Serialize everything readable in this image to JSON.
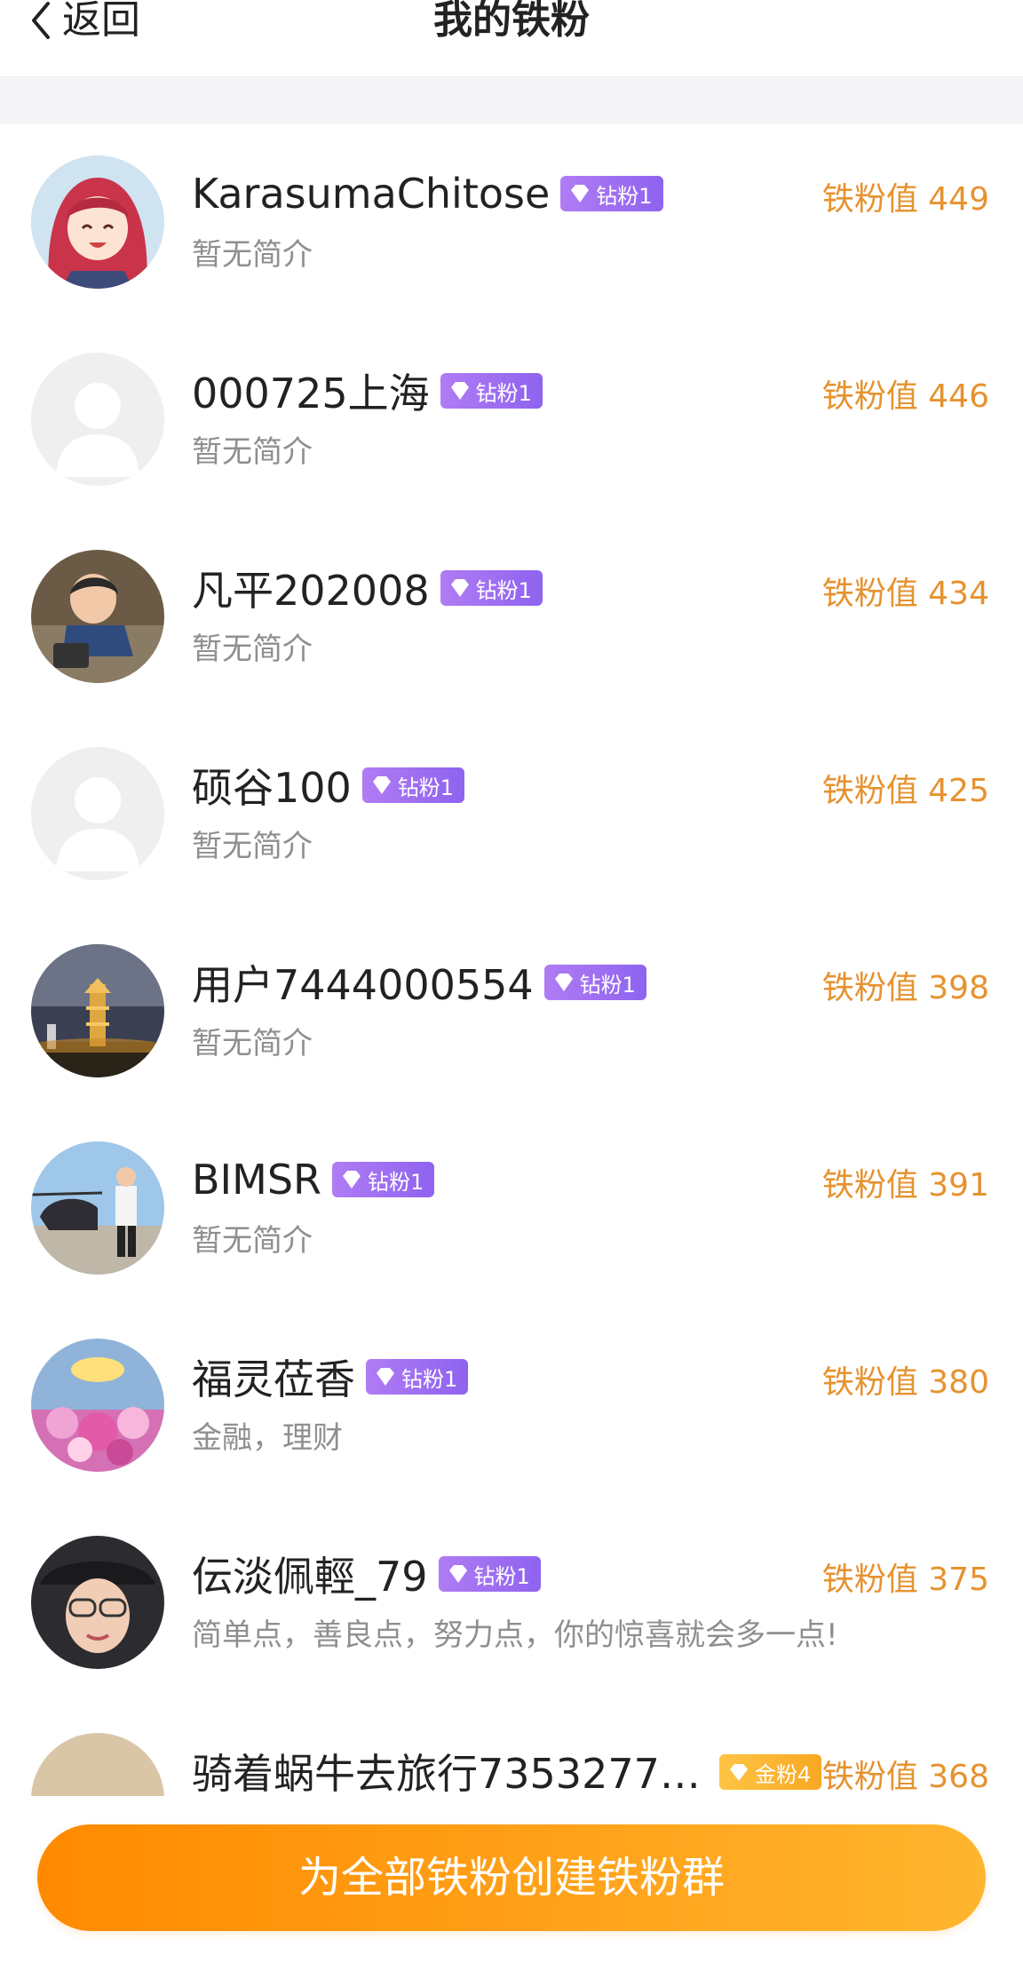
{
  "header": {
    "back_label": "返回",
    "title": "我的铁粉"
  },
  "fans": [
    {
      "name": "KarasumaChitose",
      "badge": "钻粉1",
      "badge_type": "diamond",
      "bio": "暂无简介",
      "score": "铁粉值 449",
      "avatar": "anime-girl"
    },
    {
      "name": "000725上海",
      "badge": "钻粉1",
      "badge_type": "diamond",
      "bio": "暂无简介",
      "score": "铁粉值 446",
      "avatar": "default"
    },
    {
      "name": "凡平202008",
      "badge": "钻粉1",
      "badge_type": "diamond",
      "bio": "暂无简介",
      "score": "铁粉值 434",
      "avatar": "child-photo"
    },
    {
      "name": "硕谷100",
      "badge": "钻粉1",
      "badge_type": "diamond",
      "bio": "暂无简介",
      "score": "铁粉值 425",
      "avatar": "default"
    },
    {
      "name": "用户7444000554",
      "badge": "钻粉1",
      "badge_type": "diamond",
      "bio": "暂无简介",
      "score": "铁粉值 398",
      "avatar": "pagoda-night"
    },
    {
      "name": "BIMSR",
      "badge": "钻粉1",
      "badge_type": "diamond",
      "bio": "暂无简介",
      "score": "铁粉值 391",
      "avatar": "helicopter-photo"
    },
    {
      "name": "福灵莅香",
      "badge": "钻粉1",
      "badge_type": "diamond",
      "bio": "金融，理财",
      "score": "铁粉值 380",
      "avatar": "flowers"
    },
    {
      "name": "伝淡佩輕_79",
      "badge": "钻粉1",
      "badge_type": "diamond",
      "bio": "简单点，善良点，努力点，你的惊喜就会多一点!",
      "score": "铁粉值 375",
      "avatar": "woman-hat"
    },
    {
      "name": "骑着蜗牛去旅行7353277…",
      "badge": "金粉4",
      "badge_type": "gold",
      "bio": "",
      "score": "铁粉值 368",
      "avatar": "partial"
    }
  ],
  "cta": {
    "label": "为全部铁粉创建铁粉群"
  },
  "colors": {
    "accent_orange": "#ff8a00",
    "score_orange": "#e6922f",
    "diamond_purple": "#9b6cf1",
    "gold": "#f7a823"
  }
}
